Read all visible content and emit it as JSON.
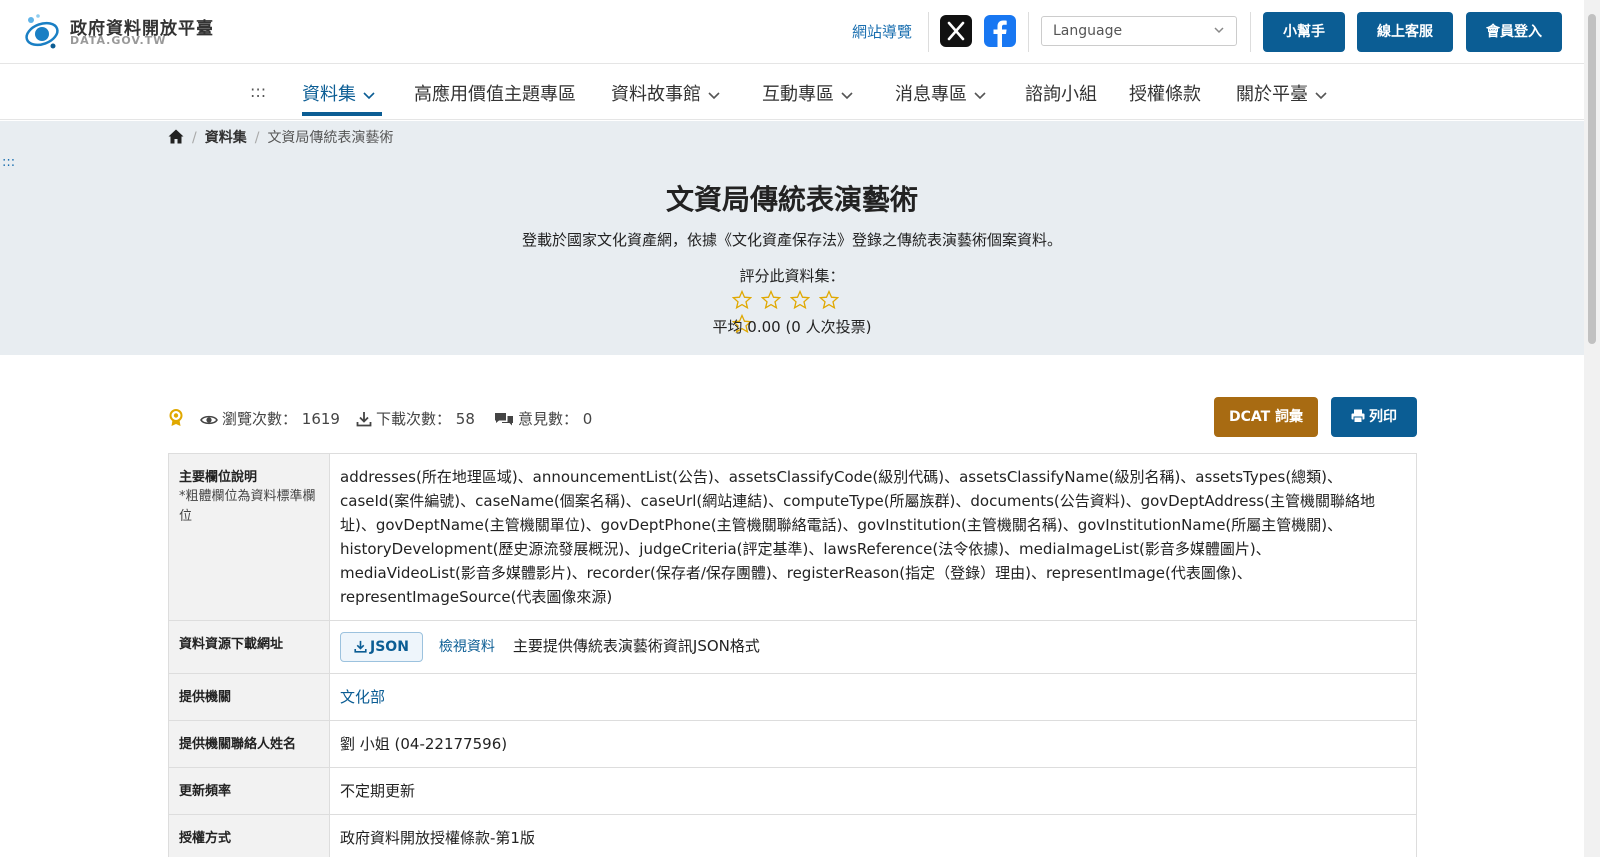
{
  "header": {
    "logo_title": "政府資料開放平臺",
    "logo_sub": "DATA.GOV.TW",
    "sitemap_label": "網站導覽",
    "language_placeholder": "Language",
    "helper_label": "小幫手",
    "support_label": "線上客服",
    "login_label": "會員登入",
    "brand_color": "#0b5d94"
  },
  "nav": {
    "skip": ":::",
    "items": [
      {
        "label": "資料集",
        "dropdown": true,
        "active": true
      },
      {
        "label": "高應用價值主題專區",
        "dropdown": false
      },
      {
        "label": "資料故事館",
        "dropdown": true
      },
      {
        "label": "互動專區",
        "dropdown": true
      },
      {
        "label": "消息專區",
        "dropdown": true
      },
      {
        "label": "諮詢小組",
        "dropdown": false
      },
      {
        "label": "授權條款",
        "dropdown": false
      },
      {
        "label": "關於平臺",
        "dropdown": true
      }
    ]
  },
  "breadcrumb": {
    "level1": "資料集",
    "current": "文資局傳統表演藝術"
  },
  "hero": {
    "skip": ":::",
    "title": "文資局傳統表演藝術",
    "description": "登載於國家文化資產網，依據《文化資產保存法》登錄之傳統表演藝術個案資料。",
    "rate_label": "評分此資料集：",
    "rating": 0,
    "rating_max": 5,
    "average": "平均 0.00 (0 人次投票)"
  },
  "stats": {
    "views_label": "瀏覽次數：",
    "views": "1619",
    "downloads_label": "下載次數：",
    "downloads": "58",
    "comments_label": "意見數：",
    "comments": "0"
  },
  "actions": {
    "dcat_label": "DCAT 詞彙",
    "print_label": "列印"
  },
  "details": {
    "fields_key": "主要欄位說明",
    "fields_note": "*粗體欄位為資料標準欄位",
    "fields_value": "addresses(所在地理區域)、announcementList(公告)、assetsClassifyCode(級別代碼)、assetsClassifyName(級別名稱)、assetsTypes(總類)、caseId(案件編號)、caseName(個案名稱)、caseUrl(網站連結)、computeType(所屬族群)、documents(公告資料)、govDeptAddress(主管機關聯絡地址)、govDeptName(主管機關單位)、govDeptPhone(主管機關聯絡電話)、govInstitution(主管機關名稱)、govInstitutionName(所屬主管機關)、historyDevelopment(歷史源流發展概況)、judgeCriteria(評定基準)、lawsReference(法令依據)、mediaImageList(影音多媒體圖片)、mediaVideoList(影音多媒體影片)、recorder(保存者/保存團體)、registerReason(指定（登錄）理由)、representImage(代表圖像)、representImageSource(代表圖像來源)",
    "download_key": "資料資源下載網址",
    "download_format": "JSON",
    "download_view": "檢視資料",
    "download_desc": "主要提供傳統表演藝術資訊JSON格式",
    "provider_key": "提供機關",
    "provider_value": "文化部",
    "contact_key": "提供機關聯絡人姓名",
    "contact_value": "劉 小姐 (04-22177596)",
    "frequency_key": "更新頻率",
    "frequency_value": "不定期更新",
    "license_key": "授權方式",
    "license_value": "政府資料開放授權條款-第1版"
  }
}
